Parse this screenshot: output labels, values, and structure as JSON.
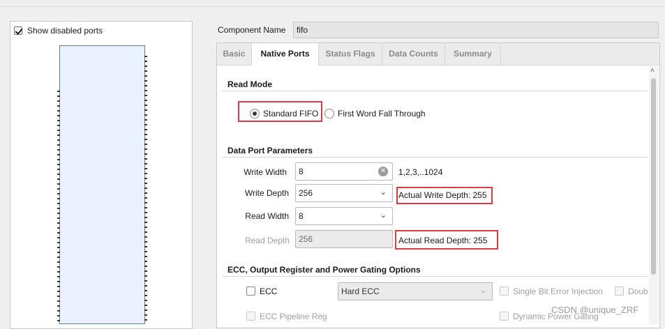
{
  "left_panel": {
    "show_disabled_ports_label": "Show disabled ports",
    "show_disabled_ports_checked": true
  },
  "component": {
    "label": "Component Name",
    "value": "fifo"
  },
  "tabs": [
    {
      "label": "Basic",
      "active": false
    },
    {
      "label": "Native Ports",
      "active": true
    },
    {
      "label": "Status Flags",
      "active": false
    },
    {
      "label": "Data Counts",
      "active": false
    },
    {
      "label": "Summary",
      "active": false
    }
  ],
  "read_mode": {
    "title": "Read Mode",
    "options": [
      {
        "label": "Standard FIFO",
        "selected": true
      },
      {
        "label": "First Word Fall Through",
        "selected": false
      }
    ]
  },
  "data_port": {
    "title": "Data Port Parameters",
    "write_width": {
      "label": "Write Width",
      "value": "8",
      "hint": "1,2,3,..1024"
    },
    "write_depth": {
      "label": "Write Depth",
      "value": "256",
      "actual": "Actual Write Depth: 255"
    },
    "read_width": {
      "label": "Read Width",
      "value": "8"
    },
    "read_depth": {
      "label": "Read Depth",
      "value": "256",
      "actual": "Actual Read Depth: 255"
    }
  },
  "ecc": {
    "title": "ECC, Output Register and Power Gating Options",
    "ecc_label": "ECC",
    "ecc_type": "Hard ECC",
    "single_bit_label": "Single Bit Error Injection",
    "double_bit_label": "Doub",
    "ecc_pipeline_label": "ECC Pipeline Reg",
    "dynamic_power_label": "Dynamic Power Gating"
  },
  "watermark": "CSDN @unique_ZRF",
  "colors": {
    "highlight_border": "#e03a3a",
    "symbol_fill": "#eaf3fd",
    "symbol_border": "#5b7bb3"
  }
}
